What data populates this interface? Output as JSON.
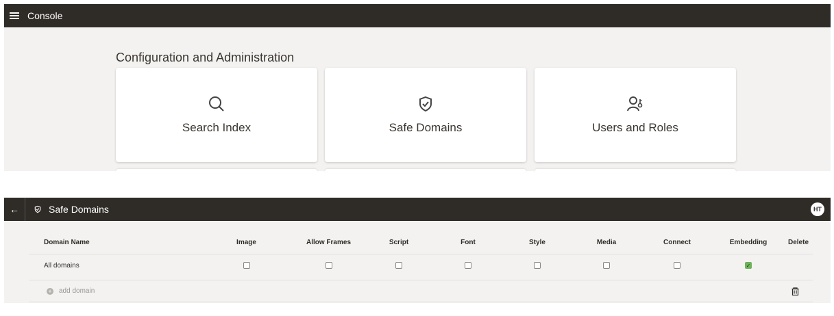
{
  "console": {
    "title": "Console",
    "heading": "Configuration and Administration",
    "cards": [
      {
        "label": "Search Index",
        "icon": "search-icon"
      },
      {
        "label": "Safe Domains",
        "icon": "shield-check-icon"
      },
      {
        "label": "Users and Roles",
        "icon": "user-key-icon"
      }
    ]
  },
  "safe_domains": {
    "title": "Safe Domains",
    "avatar": "HT",
    "columns": [
      "Domain Name",
      "Image",
      "Allow Frames",
      "Script",
      "Font",
      "Style",
      "Media",
      "Connect",
      "Embedding",
      "Delete"
    ],
    "rows": [
      {
        "domain": "All domains",
        "image": false,
        "allow_frames": false,
        "script": false,
        "font": false,
        "style": false,
        "media": false,
        "connect": false,
        "embedding": true
      }
    ],
    "add_label": "add domain",
    "accent": "#6cb35a"
  }
}
